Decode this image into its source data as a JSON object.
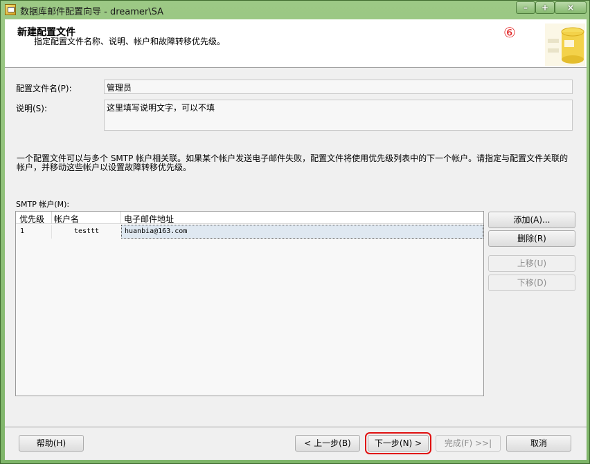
{
  "window": {
    "title": "数据库邮件配置向导 - dreamer\\SA",
    "min_label": "–",
    "max_label": "+",
    "close_label": "×"
  },
  "header": {
    "title": "新建配置文件",
    "subtitle": "指定配置文件名称、说明、帐户和故障转移优先级。",
    "step_marker": "⑥"
  },
  "form": {
    "profile_name_label": "配置文件名(P):",
    "profile_name_value": "管理员",
    "description_label": "说明(S):",
    "description_value": "这里填写说明文字，可以不填"
  },
  "info_text": "一个配置文件可以与多个 SMTP 帐户相关联。如果某个帐户发送电子邮件失败，配置文件将使用优先级列表中的下一个帐户。请指定与配置文件关联的帐户，并移动这些帐户以设置故障转移优先级。",
  "smtp": {
    "label": "SMTP 帐户(M):",
    "columns": [
      "优先级",
      "帐户名",
      "电子邮件地址"
    ],
    "rows": [
      {
        "priority": "1",
        "account": "testtt",
        "email": "huanbia@163.com"
      }
    ],
    "buttons": {
      "add": "添加(A)...",
      "remove": "删除(R)",
      "up": "上移(U)",
      "down": "下移(D)"
    }
  },
  "footer": {
    "help": "帮助(H)",
    "back": "< 上一步(B)",
    "next": "下一步(N) >",
    "finish": "完成(F) >>|",
    "cancel": "取消"
  },
  "colors": {
    "highlight": "#e01010",
    "window_frame": "#7fb56a"
  }
}
